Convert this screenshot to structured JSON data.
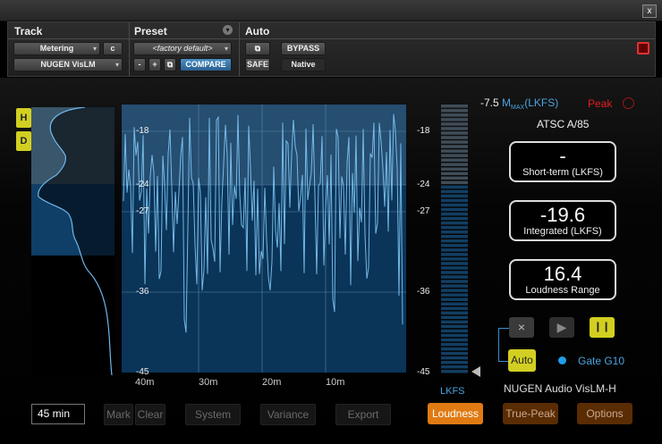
{
  "window": {
    "close_label": "x"
  },
  "host": {
    "track_title": "Track",
    "preset_title": "Preset",
    "auto_title": "Auto",
    "track_insert": "Metering",
    "track_insert_channel": "c",
    "plugin_name": "NUGEN VisLM",
    "preset_name": "<factory default>",
    "minus_label": "-",
    "plus_label": "+",
    "compare_label": "COMPARE",
    "bypass_label": "BYPASS",
    "safe_label": "SAFE",
    "native_label": "Native"
  },
  "history": {
    "side_buttons": [
      "H",
      "D"
    ],
    "left_scale": [
      "-18",
      "-24",
      "-27",
      "-36",
      "-45"
    ],
    "right_scale": [
      "-18",
      "-24",
      "-27",
      "-36",
      "-45"
    ],
    "time_labels": [
      "40m",
      "30m",
      "20m",
      "10m"
    ]
  },
  "meter": {
    "unit": "LKFS",
    "level_fraction": 0.0
  },
  "readouts": {
    "max_value": "-7.5",
    "max_prefix": "M",
    "max_sub": "MAX",
    "max_unit": "(LKFS)",
    "peak_label": "Peak",
    "standard": "ATSC A/85",
    "short_term_value": "-",
    "short_term_label": "Short-term (LKFS)",
    "integrated_value": "-19.6",
    "integrated_label": "Integrated (LKFS)",
    "range_value": "16.4",
    "range_label": "Loudness Range"
  },
  "transport": {
    "reset_icon": "×",
    "play_icon": "▶",
    "pause_icon": "❙❙",
    "auto_label": "Auto",
    "gate_label": "Gate G10"
  },
  "brand": "NUGEN Audio VisLM-H",
  "bottom": {
    "duration": "45 min",
    "mark_label": "Mark",
    "clear_label": "Clear",
    "system_label": "System",
    "variance_label": "Variance",
    "export_label": "Export",
    "tabs": [
      "Loudness",
      "True-Peak",
      "Options"
    ]
  },
  "colors": {
    "accent_blue": "#4aa3e0",
    "highlight_yellow": "#d2cf22",
    "tab_orange": "#e07a12",
    "peak_red": "#e02020"
  }
}
